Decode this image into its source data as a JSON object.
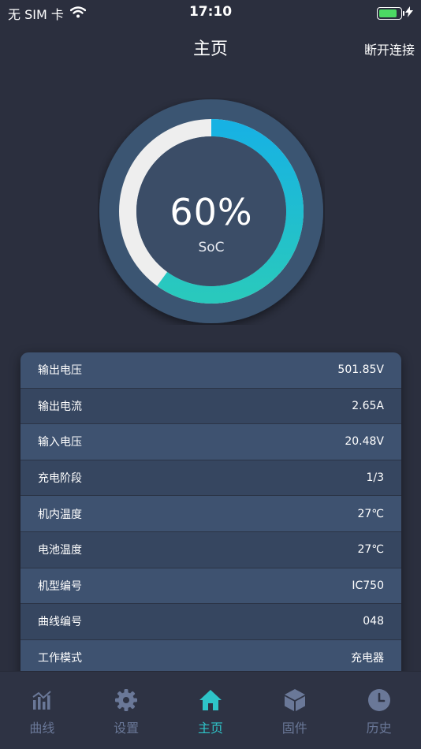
{
  "status_bar": {
    "carrier": "无 SIM 卡",
    "time": "17:10",
    "battery_level": 0.85
  },
  "nav": {
    "title": "主页",
    "right_action": "断开连接"
  },
  "gauge": {
    "value": "60%",
    "fraction": 0.6,
    "label": "SoC",
    "colors": {
      "start": "#29c9bd",
      "end": "#17b2e3",
      "track": "#eeeeee",
      "outer": "#3a5572",
      "inner": "#3b4d67"
    }
  },
  "info": {
    "rows": [
      {
        "label": "输出电压",
        "value": "501.85V"
      },
      {
        "label": "输出电流",
        "value": "2.65A"
      },
      {
        "label": "输入电压",
        "value": "20.48V"
      },
      {
        "label": "充电阶段",
        "value": "1/3"
      },
      {
        "label": "机内温度",
        "value": "27℃"
      },
      {
        "label": "电池温度",
        "value": "27℃"
      },
      {
        "label": "机型编号",
        "value": "IC750"
      },
      {
        "label": "曲线编号",
        "value": "048"
      },
      {
        "label": "工作模式",
        "value": "充电器"
      }
    ]
  },
  "tabs": [
    {
      "label": "曲线",
      "icon": "chart-icon"
    },
    {
      "label": "设置",
      "icon": "gear-icon"
    },
    {
      "label": "主页",
      "icon": "home-icon",
      "active": true
    },
    {
      "label": "固件",
      "icon": "cube-icon"
    },
    {
      "label": "历史",
      "icon": "clock-icon"
    }
  ],
  "colors": {
    "accent": "#2ec4c9",
    "inactive": "#6a7898",
    "background": "#2b2f3e"
  }
}
